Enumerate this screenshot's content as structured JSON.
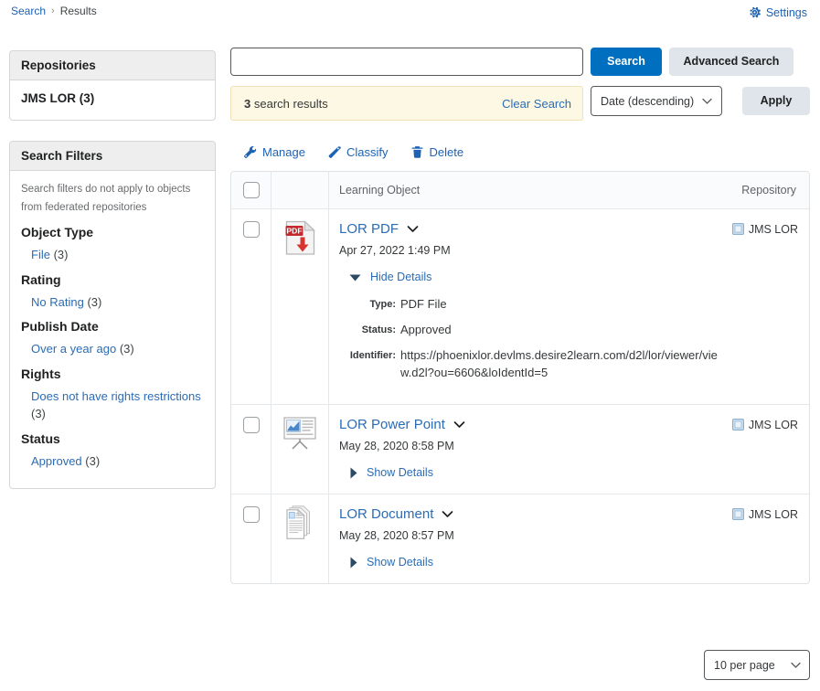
{
  "breadcrumb": {
    "root": "Search",
    "separator": "›",
    "current": "Results"
  },
  "settings": {
    "label": "Settings",
    "icon": "gear-icon"
  },
  "sidebar": {
    "repositories": {
      "title": "Repositories",
      "items": [
        {
          "label": "JMS LOR (3)"
        }
      ]
    },
    "filters": {
      "title": "Search Filters",
      "note": "Search filters do not apply to objects from federated repositories",
      "groups": [
        {
          "title": "Object Type",
          "options": [
            {
              "label": "File",
              "count": "(3)"
            }
          ]
        },
        {
          "title": "Rating",
          "options": [
            {
              "label": "No Rating",
              "count": "(3)"
            }
          ]
        },
        {
          "title": "Publish Date",
          "options": [
            {
              "label": "Over a year ago",
              "count": "(3)"
            }
          ]
        },
        {
          "title": "Rights",
          "options": [
            {
              "label": "Does not have rights restrictions",
              "count": "(3)"
            }
          ]
        },
        {
          "title": "Status",
          "options": [
            {
              "label": "Approved",
              "count": "(3)"
            }
          ]
        }
      ]
    }
  },
  "search": {
    "value": "",
    "placeholder": "",
    "search_button": "Search",
    "advanced_button": "Advanced Search",
    "results_count": "3",
    "results_text": "search results",
    "clear_label": "Clear Search",
    "sort_value": "Date (descending)",
    "apply_button": "Apply"
  },
  "toolbar": {
    "manage": "Manage",
    "classify": "Classify",
    "delete": "Delete"
  },
  "table": {
    "headers": {
      "learning_object": "Learning Object",
      "repository": "Repository"
    },
    "rows": [
      {
        "title": "LOR PDF",
        "date": "Apr 27, 2022 1:49 PM",
        "icon": "pdf-file-icon",
        "repository": "JMS LOR",
        "details_toggle": "Hide Details",
        "expanded": true,
        "details": [
          {
            "label": "Type:",
            "value": "PDF File"
          },
          {
            "label": "Status:",
            "value": "Approved"
          },
          {
            "label": "Identifier:",
            "value": "https://phoenixlor.devlms.desire2learn.com/d2l/lor/viewer/view.d2l?ou=6606&loIdentId=5"
          }
        ]
      },
      {
        "title": "LOR Power Point",
        "date": "May 28, 2020 8:58 PM",
        "icon": "presentation-icon",
        "repository": "JMS LOR",
        "details_toggle": "Show Details",
        "expanded": false,
        "details": []
      },
      {
        "title": "LOR Document",
        "date": "May 28, 2020 8:57 PM",
        "icon": "document-icon",
        "repository": "JMS LOR",
        "details_toggle": "Show Details",
        "expanded": false,
        "details": []
      }
    ]
  },
  "footer": {
    "per_page": "10 per page"
  },
  "colors": {
    "link": "#2b6cb5",
    "primary_button": "#006fbf",
    "banner_bg": "#fdf8e3",
    "panel_head_bg": "#eeeeee"
  }
}
